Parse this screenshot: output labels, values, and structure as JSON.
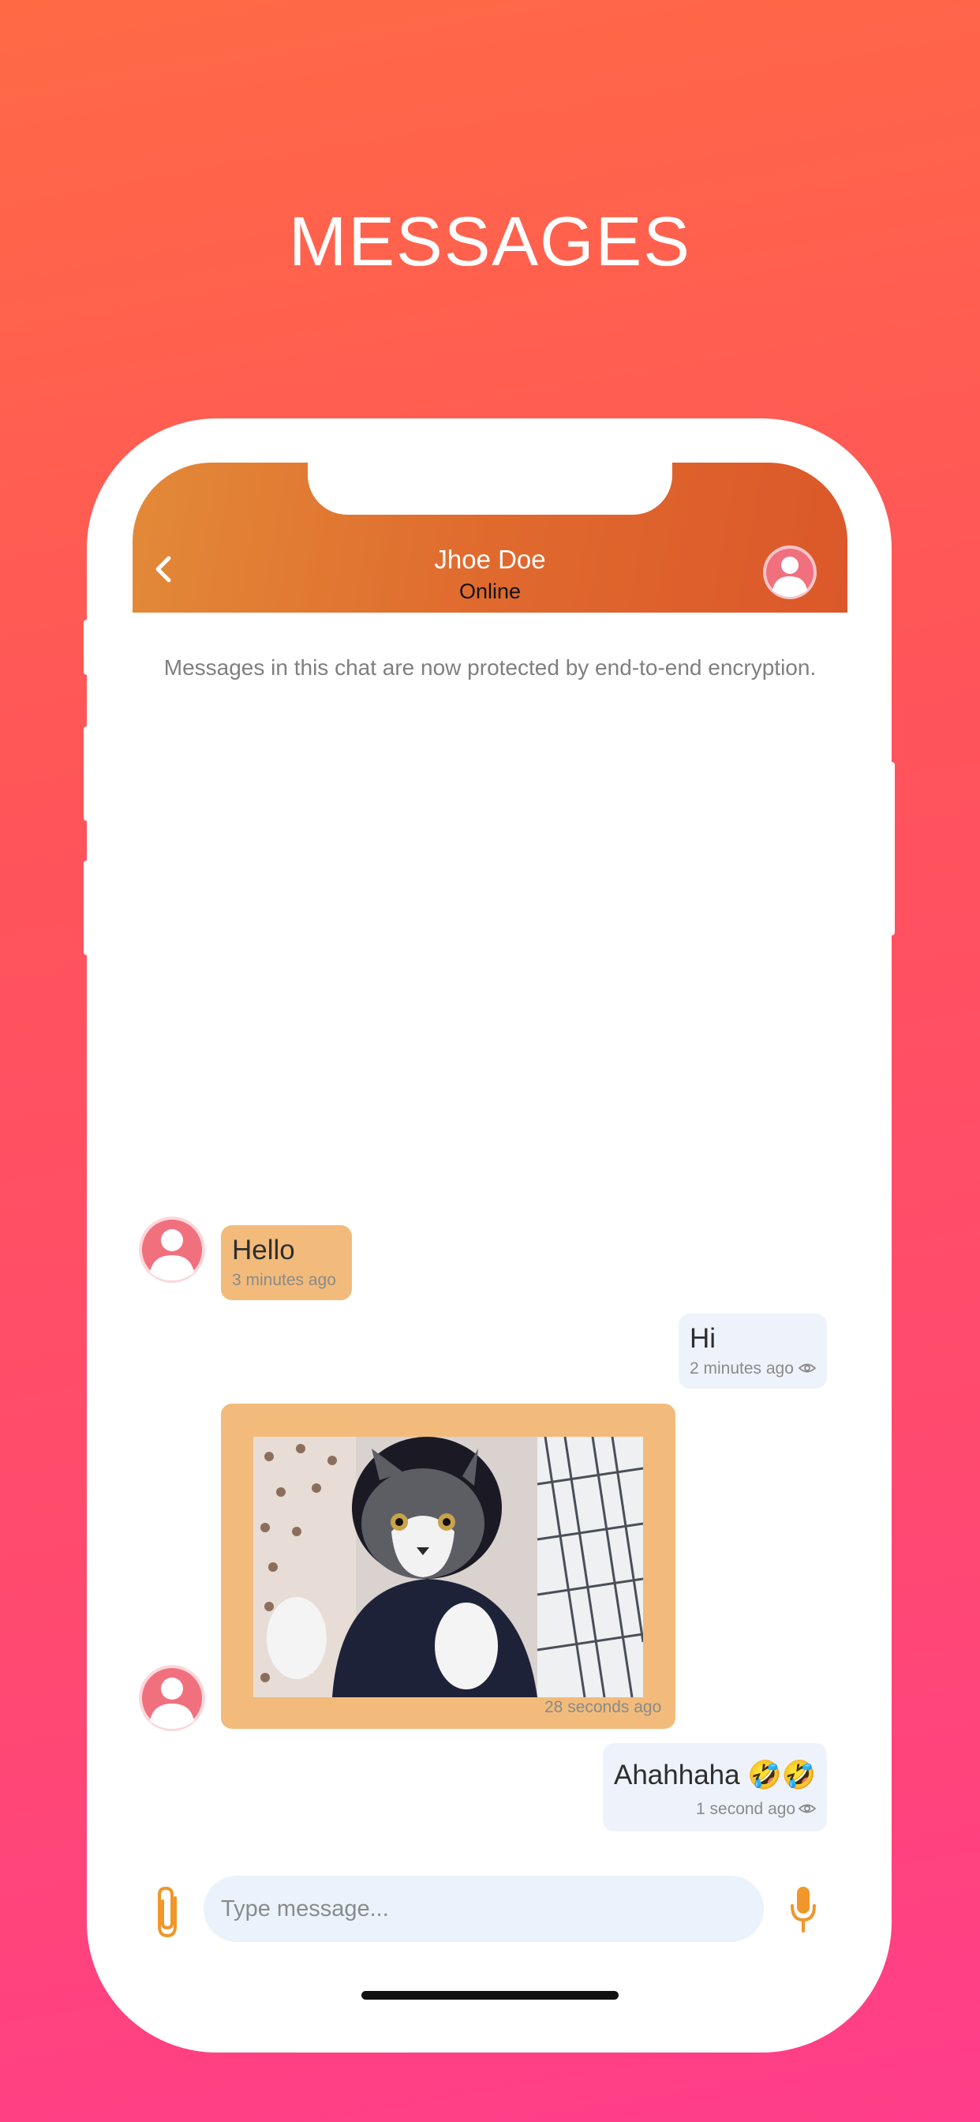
{
  "page": {
    "headline": "MESSAGES",
    "colors": {
      "background_top": "#ff6a45",
      "background_bottom": "#ff3d8a",
      "header_orange": "#e06a2e",
      "incoming_bubble": "#f2bb7b",
      "outgoing_bubble": "#eef3fb",
      "accent_icon": "#f0962a"
    }
  },
  "header": {
    "back_icon": "chevron-left-icon",
    "contact_name": "Jhoe Doe",
    "status": "Online",
    "avatar_icon": "user-avatar-icon"
  },
  "encryption_note": "Messages in this chat are now protected by end-to-end encryption.",
  "messages": [
    {
      "direction": "incoming",
      "text": "Hello",
      "time": "3 minutes ago"
    },
    {
      "direction": "outgoing",
      "text": "Hi",
      "time": "2 minutes ago",
      "seen_icon": "eye-icon"
    },
    {
      "direction": "incoming",
      "type": "image",
      "image_subject": "cat photo",
      "time": "28 seconds ago"
    },
    {
      "direction": "outgoing",
      "text": "Ahahhaha 🤣🤣",
      "time": "1 second ago",
      "seen_icon": "eye-icon"
    }
  ],
  "composer": {
    "attach_icon": "paperclip-icon",
    "placeholder": "Type message...",
    "mic_icon": "microphone-icon"
  }
}
